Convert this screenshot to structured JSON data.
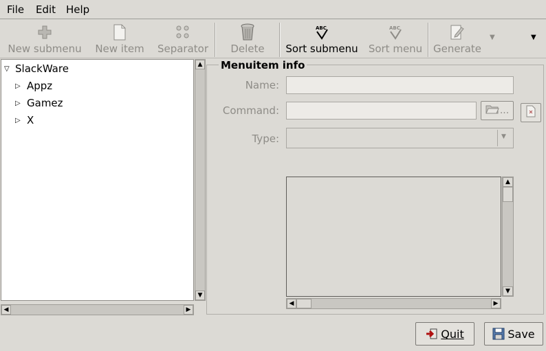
{
  "menubar": {
    "file": "File",
    "edit": "Edit",
    "help": "Help"
  },
  "toolbar": {
    "new_submenu": "New submenu",
    "new_item": "New item",
    "separator": "Separator",
    "delete": "Delete",
    "sort_submenu": "Sort submenu",
    "sort_menu": "Sort menu",
    "generate": "Generate"
  },
  "tree": {
    "root": "SlackWare",
    "children": [
      "Appz",
      "Gamez",
      "X"
    ]
  },
  "info": {
    "section_title": "Menuitem info",
    "name_label": "Name:",
    "name_value": "",
    "command_label": "Command:",
    "command_value": "",
    "browse_label": "...",
    "type_label": "Type:",
    "type_value": ""
  },
  "buttons": {
    "quit": "Quit",
    "save": "Save"
  }
}
